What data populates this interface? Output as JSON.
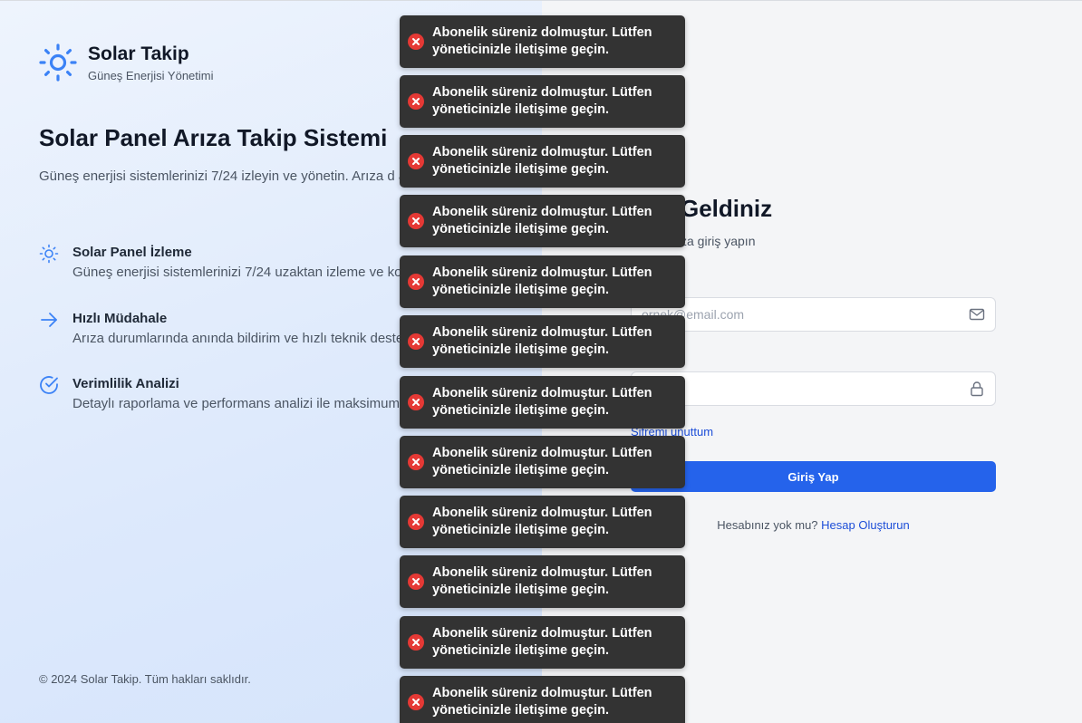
{
  "brand": {
    "name": "Solar Takip",
    "subtitle": "Güneş Enerjisi Yönetimi"
  },
  "hero": {
    "title": "Solar Panel Arıza Takip Sistemi",
    "description": "Güneş enerjisi sistemlerinizi 7/24 izleyin ve yönetin. Arıza d anında müdahale edin."
  },
  "features": [
    {
      "icon": "sun-icon",
      "title": "Solar Panel İzleme",
      "description": "Güneş enerjisi sistemlerinizi 7/24 uzaktan izleme ve ko"
    },
    {
      "icon": "arrow-right-icon",
      "title": "Hızlı Müdahale",
      "description": "Arıza durumlarında anında bildirim ve hızlı teknik deste"
    },
    {
      "icon": "check-circle-icon",
      "title": "Verimlilik Analizi",
      "description": "Detaylı raporlama ve performans analizi ile maksimum"
    }
  ],
  "copyright": "© 2024 Solar Takip. Tüm hakları saklıdır.",
  "login": {
    "welcome": "Geldiniz",
    "subtitle": "za giriş yapın",
    "email_placeholder": "ornek@email.com",
    "password_value": "••••••",
    "forgot": "Şifremi unuttum",
    "submit": "Giriş Yap",
    "no_account": "Hesabınız yok mu?",
    "create_account": "Hesap Oluşturun"
  },
  "toasts": [
    "Abonelik süreniz dolmuştur. Lütfen yöneticinizle iletişime geçin.",
    "Abonelik süreniz dolmuştur. Lütfen yöneticinizle iletişime geçin.",
    "Abonelik süreniz dolmuştur. Lütfen yöneticinizle iletişime geçin.",
    "Abonelik süreniz dolmuştur. Lütfen yöneticinizle iletişime geçin.",
    "Abonelik süreniz dolmuştur. Lütfen yöneticinizle iletişime geçin.",
    "Abonelik süreniz dolmuştur. Lütfen yöneticinizle iletişime geçin.",
    "Abonelik süreniz dolmuştur. Lütfen yöneticinizle iletişime geçin.",
    "Abonelik süreniz dolmuştur. Lütfen yöneticinizle iletişime geçin.",
    "Abonelik süreniz dolmuştur. Lütfen yöneticinizle iletişime geçin.",
    "Abonelik süreniz dolmuştur. Lütfen yöneticinizle iletişime geçin.",
    "Abonelik süreniz dolmuştur. Lütfen yöneticinizle iletişime geçin.",
    "Abonelik süreniz dolmuştur. Lütfen yöneticinizle iletişime geçin."
  ],
  "colors": {
    "accent": "#2563eb",
    "error": "#e53935",
    "toast_bg": "#333333"
  }
}
